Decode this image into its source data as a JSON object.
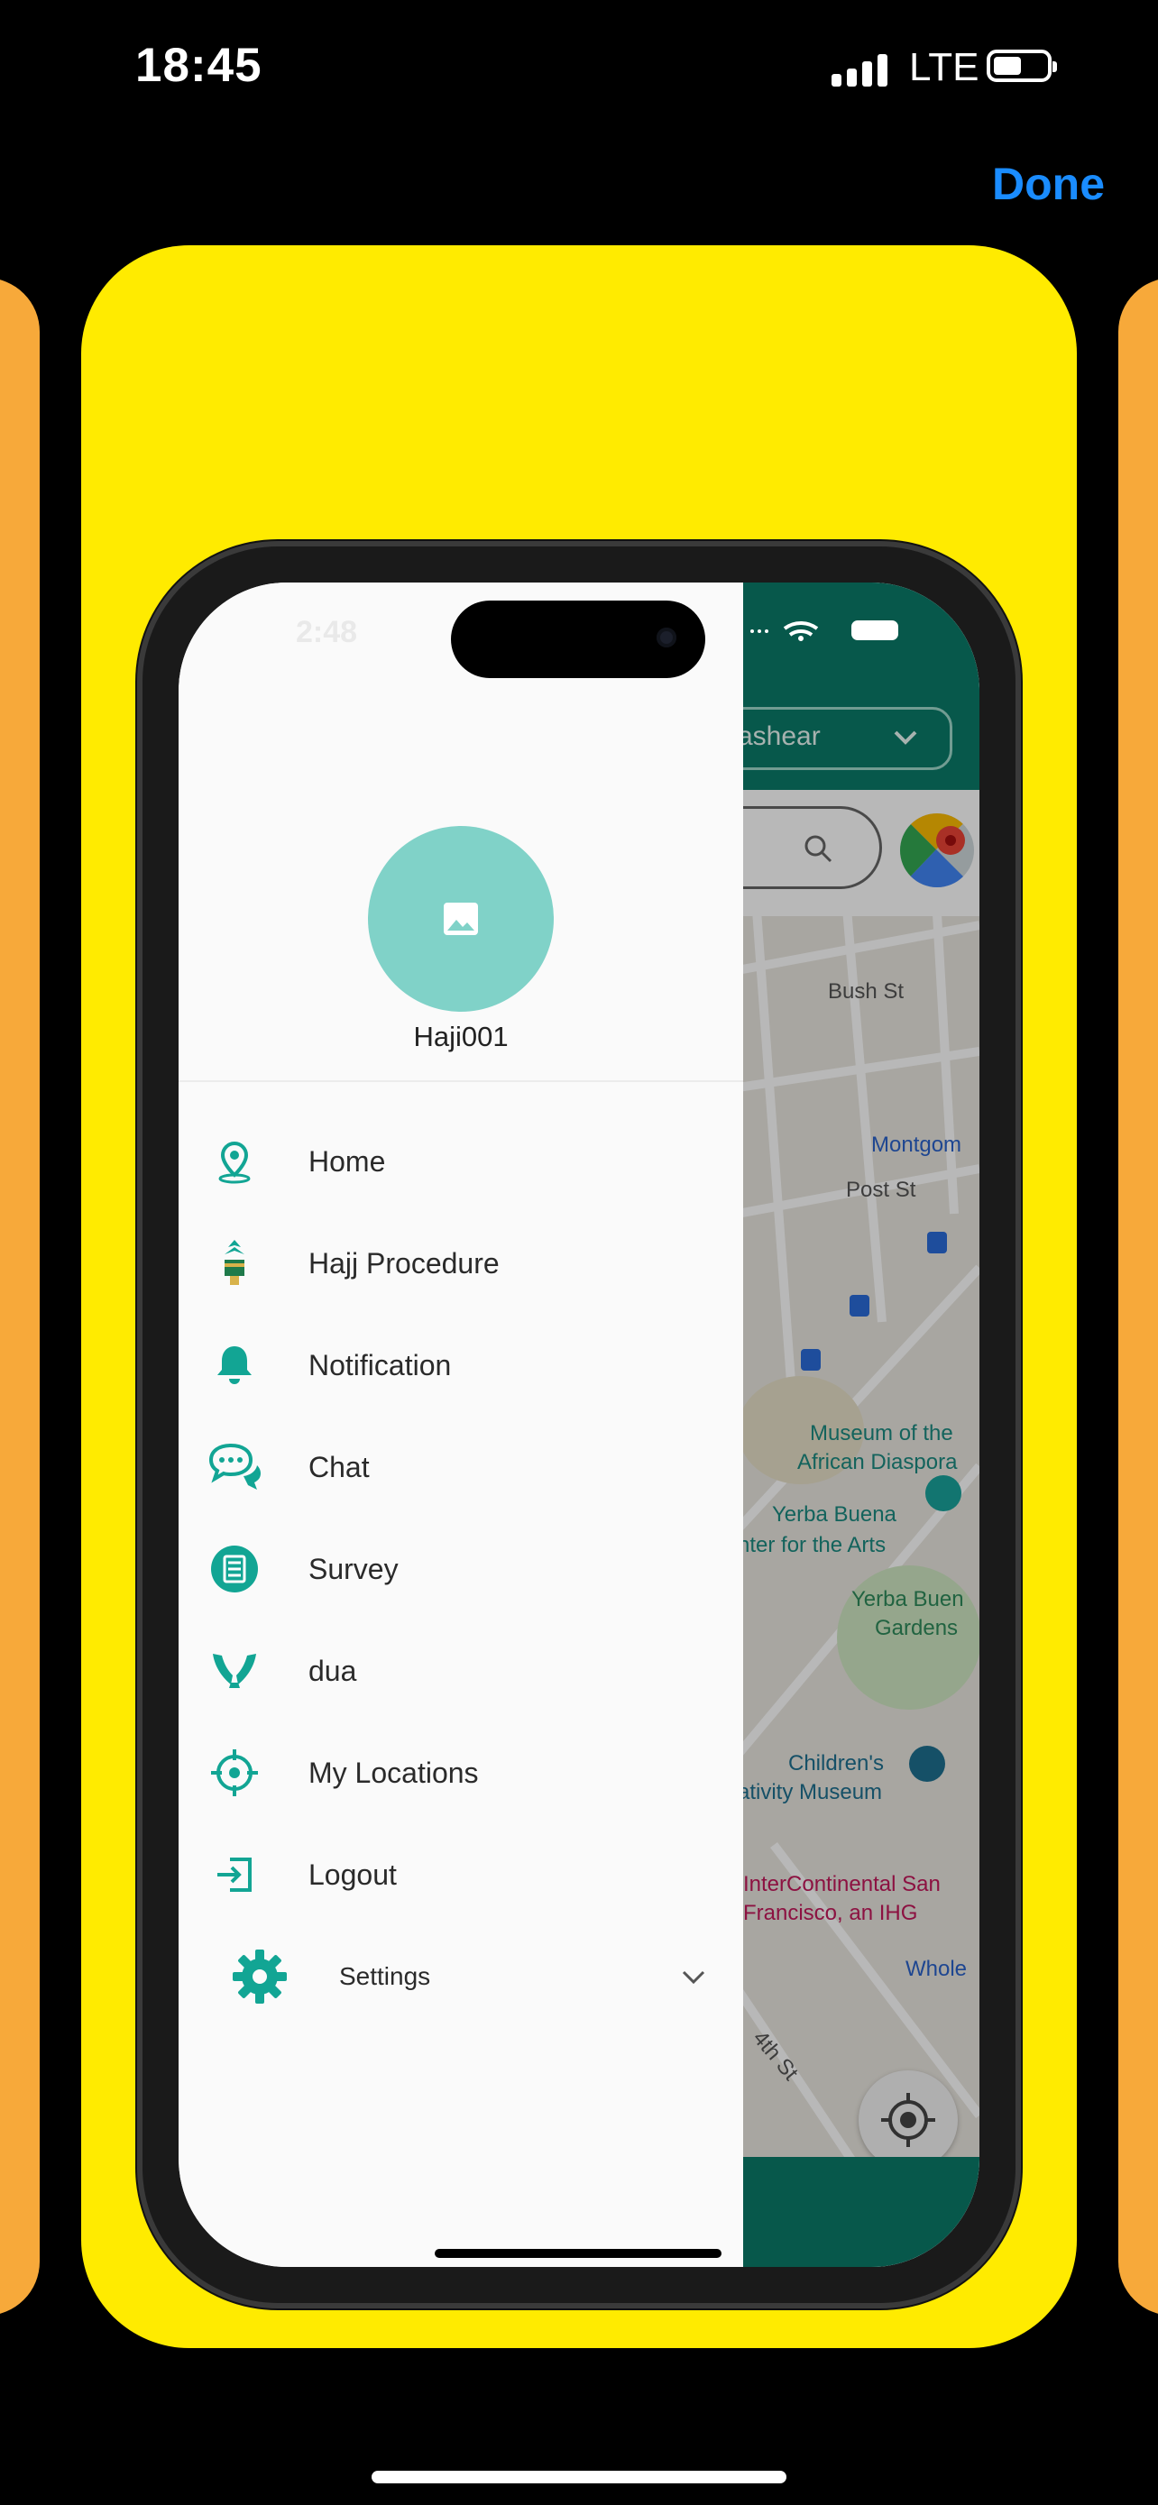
{
  "status_bar": {
    "time": "18:45",
    "network": "LTE"
  },
  "header": {
    "done_label": "Done"
  },
  "preview": {
    "faded_time": "2:48",
    "drawer": {
      "username": "Haji001",
      "menu": [
        {
          "label": "Home",
          "icon": "location-pin-icon"
        },
        {
          "label": "Hajj Procedure",
          "icon": "kaaba-icon"
        },
        {
          "label": "Notification",
          "icon": "bell-icon"
        },
        {
          "label": "Chat",
          "icon": "chat-bubbles-icon"
        },
        {
          "label": "Survey",
          "icon": "survey-list-icon"
        },
        {
          "label": "dua",
          "icon": "praying-hands-icon"
        },
        {
          "label": "My Locations",
          "icon": "crosshair-icon"
        },
        {
          "label": "Logout",
          "icon": "logout-icon"
        }
      ],
      "settings_label": "Settings"
    },
    "map": {
      "dropdown_text": "ashear",
      "labels": {
        "bush_st": "Bush St",
        "montgom": "Montgom",
        "post_st": "Post St",
        "museum": "Museum of the",
        "african": "African Diaspora",
        "yerba": "Yerba Buena",
        "center_arts": "nter for the Arts",
        "yerba_gardens1": "Yerba Buen",
        "yerba_gardens2": "Gardens",
        "childrens": "Children's",
        "creativity": "ativity Museum",
        "intercontinental1": "InterContinental San",
        "intercontinental2": "Francisco, an IHG",
        "whole": "Whole",
        "th_st": "4th St"
      }
    },
    "colors": {
      "accent": "#12a594",
      "card": "#ffeb00",
      "side_cards": "#f7a93a",
      "map_header": "#0a7a68"
    }
  }
}
